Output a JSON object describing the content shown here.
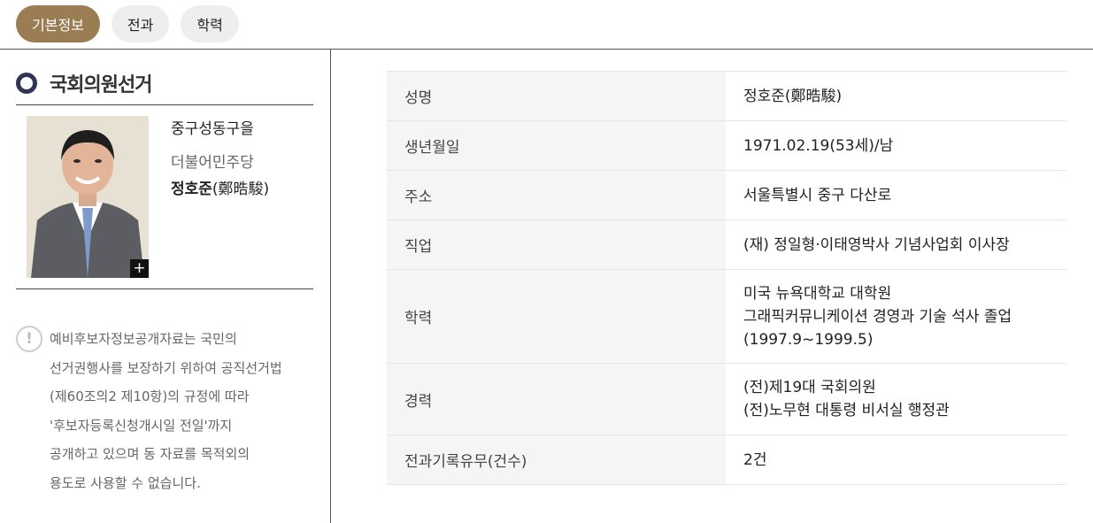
{
  "tabs": [
    "기본정보",
    "전과",
    "학력"
  ],
  "sidebar": {
    "title": "국회의원선거",
    "district": "중구성동구을",
    "party": "더불어민주당",
    "name_ko": "정호준",
    "name_hanja": "(鄭晧駿)",
    "photo_button": "+",
    "notice_icon": "!",
    "notice": "예비후보자정보공개자료는 국민의\n선거권행사를 보장하기 위하여 공직선거법\n(제60조의2 제10항)의 규정에 따라\n'후보자등록신청개시일 전일'까지\n공개하고 있으며 동 자료를 목적외의\n용도로 사용할 수 없습니다."
  },
  "info": [
    {
      "label": "성명",
      "value": "정호준(鄭晧駿)"
    },
    {
      "label": "생년월일",
      "value": "1971.02.19(53세)/남"
    },
    {
      "label": "주소",
      "value": "서울특별시 중구 다산로"
    },
    {
      "label": "직업",
      "value": "(재) 정일형·이태영박사 기념사업회 이사장"
    },
    {
      "label": "학력",
      "value": "미국 뉴욕대학교 대학원\n그래픽커뮤니케이션 경영과 기술 석사 졸업\n(1997.9~1999.5)"
    },
    {
      "label": "경력",
      "value": "(전)제19대 국회의원\n(전)노무현 대통령 비서실 행정관"
    },
    {
      "label": "전과기록유무(건수)",
      "value": "2건"
    }
  ],
  "colors": {
    "accent": "#9a7d52",
    "ring": "#2f3552"
  }
}
